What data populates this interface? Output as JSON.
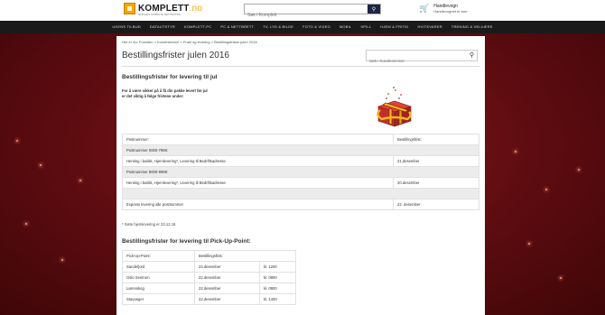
{
  "header": {
    "logo_name": "KOMPLETT",
    "logo_tld": ".no",
    "logo_tagline": "NORGES STØRSTE NETTBUTIKK",
    "search_placeholder": "Søk i Komplett",
    "cart_title": "Handlevogn",
    "cart_subtitle": "Handlevognet er tom"
  },
  "nav": [
    "UKENS TILBUD",
    "DATAUTSTYR",
    "KOMPLETT-PC",
    "PC & NETTBRETT",
    "TV, LYD & BILDE",
    "FOTO & VIDEO",
    "MOBIL",
    "SPILL",
    "HJEM & FRITID",
    "HVITEVARER",
    "TRENING & VELVÆRE"
  ],
  "breadcrumb": "Her er du: Forsiden  >  Kundeservice  >  Frakt og levering  >  Bestillingsfrister julen 2016",
  "page_title": "Bestillingsfrister julen 2016",
  "side_search_placeholder": "Søk i Kundeservice",
  "section1_title": "Bestillingsfrister for levering til jul",
  "intro_line1": "For å være sikker på å få din pakke levert før jul",
  "intro_line2": "er det viktig å følge fristene under:",
  "table1": {
    "header_col1": "Postnummer:",
    "header_col2": "Bestillingsfrist:",
    "group1": "Postnummer 0000-7999:",
    "row1_col1": "Henting i butikk, Hjemlevering*, Levering til Bedriftsadresse",
    "row1_col2": "21.desember",
    "group2": "Postnummer 8000-9999:",
    "row2_col1": "Henting i butikk, Hjemlevering*, Levering til Bedriftsadresse",
    "row2_col2": "20.desember",
    "row3_col1": "Express levering alle postnummer",
    "row3_col2": "22. desember"
  },
  "footnote": "* Siste hjemlevering er 23.12.16",
  "section2_title": "Bestillingsfrister for levering til Pick-Up-Point:",
  "table2": {
    "header_col1": "Pick-Up-Point:",
    "header_col2": "Bestillingsfrist:",
    "rows": [
      {
        "place": "Sandefjord",
        "date": "23.desember",
        "time": "kl. 1200"
      },
      {
        "place": "Oslo Sentrum",
        "date": "22.desember",
        "time": "kl. 0900"
      },
      {
        "place": "Lørenskog",
        "date": "22.desember",
        "time": "kl. 0900"
      },
      {
        "place": "Stavanger",
        "date": "22.desember",
        "time": "kl. 1400"
      }
    ]
  },
  "colors": {
    "brand_orange": "#f6a800",
    "nav_dark": "#1a1a1a",
    "background_red": "#6b0f13"
  }
}
